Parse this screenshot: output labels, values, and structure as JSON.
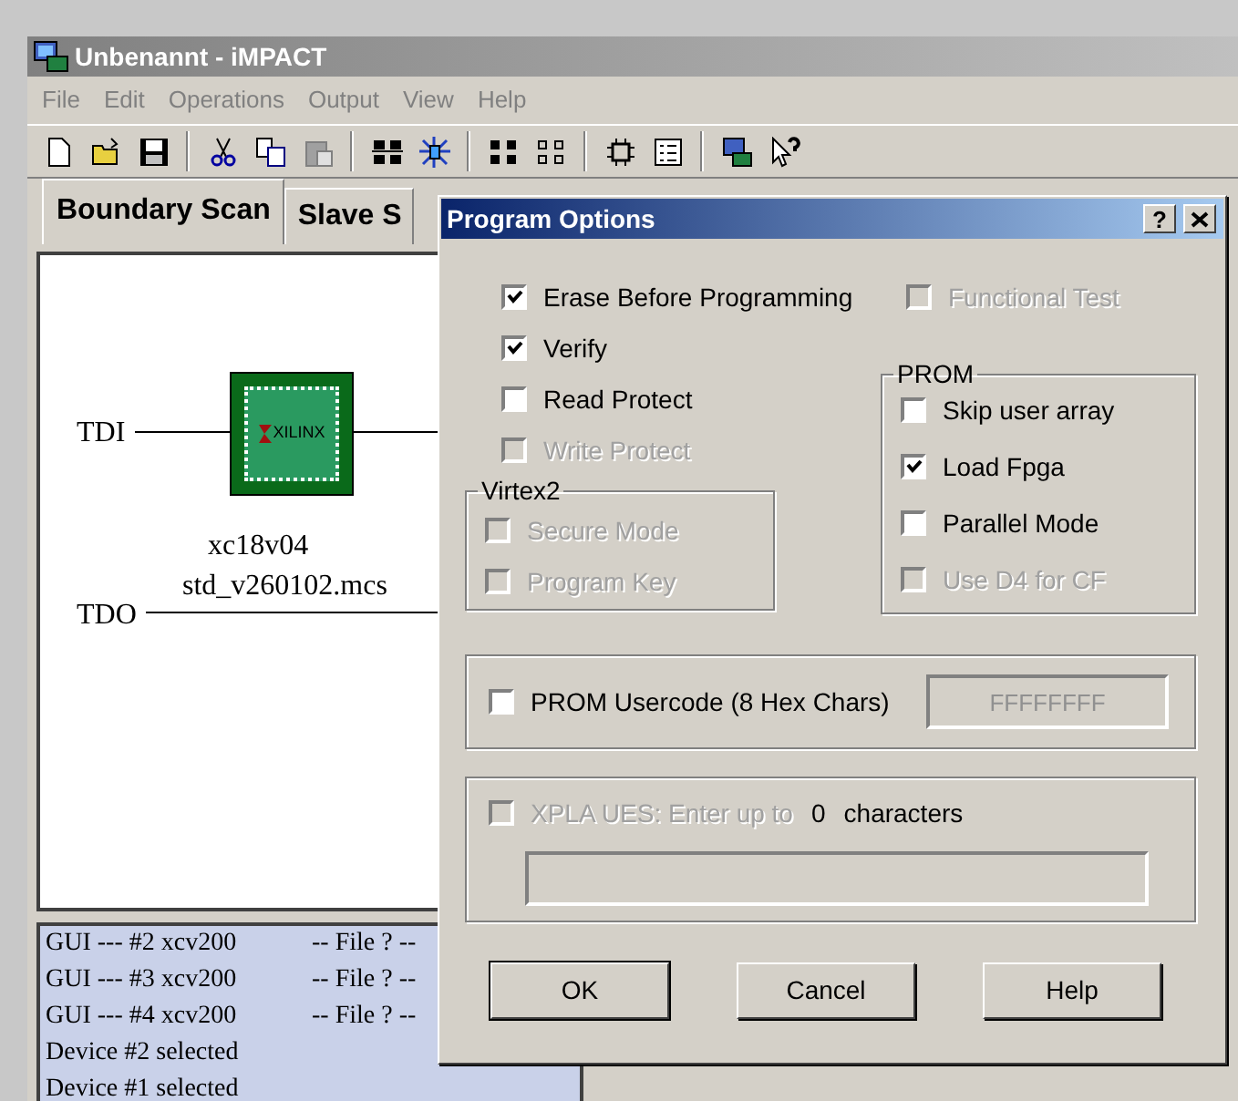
{
  "window": {
    "title": "Unbenannt - iMPACT"
  },
  "menu": [
    "File",
    "Edit",
    "Operations",
    "Output",
    "View",
    "Help"
  ],
  "tabs": [
    {
      "label": "Boundary Scan",
      "selected": true
    },
    {
      "label": "Slave S",
      "selected": false
    }
  ],
  "diagram": {
    "tdi_label": "TDI",
    "tdo_label": "TDO",
    "chip_text": "XILINX",
    "device_name": "xc18v04",
    "device_file": "std_v260102.mcs"
  },
  "log": [
    {
      "text": "GUI --- #2 xcv200",
      "file": "-- File ? --"
    },
    {
      "text": "GUI --- #3 xcv200",
      "file": "-- File ? --"
    },
    {
      "text": "GUI --- #4 xcv200",
      "file": "-- File ? --"
    },
    {
      "text": "Device #2 selected"
    },
    {
      "text": "Device #1 selected"
    }
  ],
  "dialog": {
    "title": "Program Options",
    "help_key": "?",
    "options": [
      {
        "label": "Erase Before Programming",
        "checked": true,
        "disabled": false
      },
      {
        "label": "Verify",
        "checked": true,
        "disabled": false
      },
      {
        "label": "Read Protect",
        "checked": false,
        "disabled": false
      },
      {
        "label": "Write Protect",
        "checked": false,
        "disabled": true
      }
    ],
    "functional_test": {
      "label": "Functional Test",
      "checked": false,
      "disabled": true
    },
    "virtex2": {
      "title": "Virtex2",
      "options": [
        {
          "label": "Secure Mode",
          "checked": false,
          "disabled": true
        },
        {
          "label": "Program Key",
          "checked": false,
          "disabled": true
        }
      ]
    },
    "prom": {
      "title": "PROM",
      "options": [
        {
          "label": "Skip user array",
          "checked": false,
          "disabled": false
        },
        {
          "label": "Load Fpga",
          "checked": true,
          "disabled": false
        },
        {
          "label": "Parallel Mode",
          "checked": false,
          "disabled": false
        },
        {
          "label": "Use D4 for CF",
          "checked": false,
          "disabled": true
        }
      ]
    },
    "usercode": {
      "label": "PROM Usercode (8 Hex Chars)",
      "checked": false,
      "disabled": false,
      "value": "FFFFFFFF"
    },
    "xpla": {
      "label": "XPLA UES: Enter up to",
      "checked": false,
      "disabled": true,
      "count": "0",
      "unit": "characters"
    },
    "buttons": [
      {
        "label": "OK",
        "default": true
      },
      {
        "label": "Cancel",
        "default": false
      },
      {
        "label": "Help",
        "default": false
      }
    ]
  }
}
